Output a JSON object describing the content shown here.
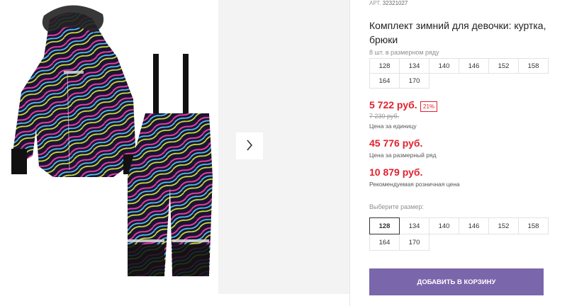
{
  "product": {
    "article_label": "АРТ.",
    "article": "32321027",
    "title": "Комплект зимний для девочки: куртка, брюки"
  },
  "pack": {
    "hint": "8 шт. в размерном ряду",
    "sizes": [
      "128",
      "134",
      "140",
      "146",
      "152",
      "158",
      "164",
      "170"
    ]
  },
  "prices": {
    "unit_price": "5 722 руб.",
    "discount": "21%",
    "old_price": "7 230 руб.",
    "unit_label": "Цена за единицу",
    "pack_price": "45 776 руб.",
    "pack_label": "Цена за размерный ряд",
    "retail_price": "10 879 руб.",
    "retail_label": "Рекомендуемая розничная цена"
  },
  "size_select": {
    "label": "Выберите размер:",
    "selected": "128",
    "sizes": [
      "128",
      "134",
      "140",
      "146",
      "152",
      "158",
      "164",
      "170"
    ]
  },
  "cart": {
    "button_label": "ДОБАВИТЬ В КОРЗИНУ"
  },
  "colors": {
    "accent": "#7a66ab",
    "price": "#e0222f"
  },
  "icons": {
    "next": "chevron-right-icon"
  }
}
